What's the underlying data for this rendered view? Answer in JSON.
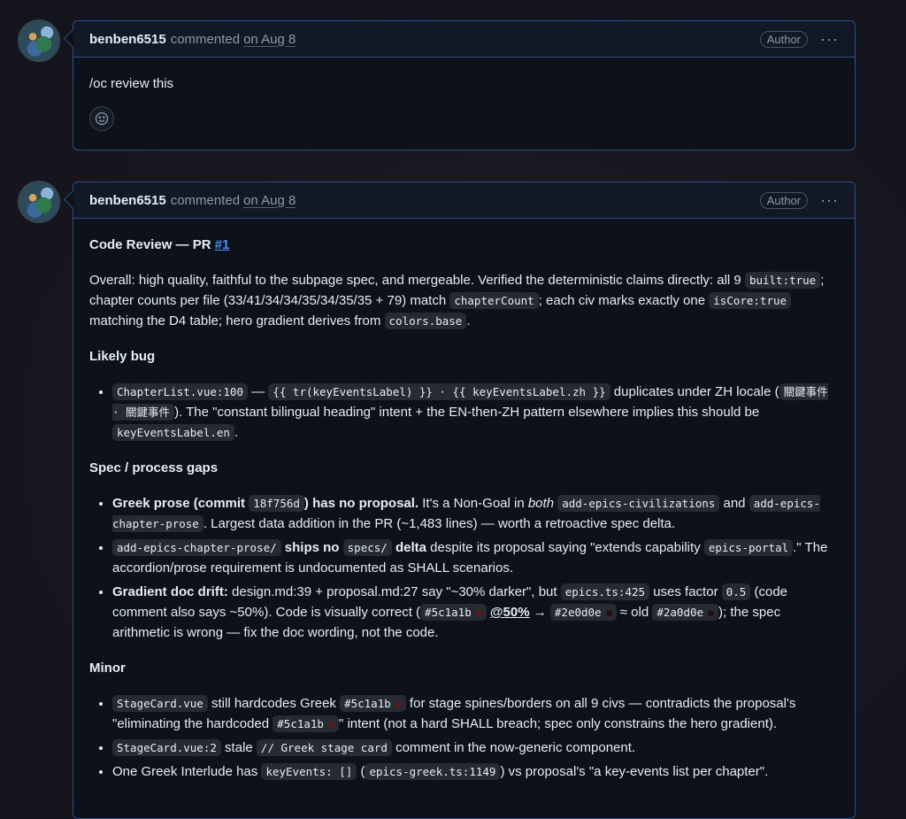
{
  "comments": [
    {
      "author": "benben6515",
      "action": "commented",
      "date": "on Aug 8",
      "badge": "Author",
      "menu": "···",
      "body": "/oc review this",
      "reaction_icon": "smiley-icon"
    },
    {
      "author": "benben6515",
      "action": "commented",
      "date": "on Aug 8",
      "badge": "Author",
      "menu": "···"
    }
  ],
  "review": {
    "title_prefix": "Code Review — PR ",
    "title_link": "#1",
    "overall": {
      "t1": "Overall: high quality, faithful to the subpage spec, and mergeable. Verified the deterministic claims directly: all 9 ",
      "c1": "built:true",
      "t2": "; chapter counts per file (33/41/34/34/35/34/35/35 + 79) match ",
      "c2": "chapterCount",
      "t3": "; each civ marks exactly one ",
      "c3": "isCore:true",
      "t4": " matching the D4 table; hero gradient derives from ",
      "c4": "colors.base",
      "t5": "."
    },
    "likely_bug": {
      "heading": "Likely bug",
      "c1": "ChapterList.vue:100",
      "t1": " — ",
      "c2": "{{ tr(keyEventsLabel) }} · {{ keyEventsLabel.zh }}",
      "t2": " duplicates under ZH locale (",
      "c3": "關鍵事件 · 關鍵事件",
      "t3": "). The \"constant bilingual heading\" intent + the EN-then-ZH pattern elsewhere implies this should be ",
      "c4": "keyEventsLabel.en",
      "t4": "."
    },
    "spec": {
      "heading": "Spec / process gaps",
      "i1": {
        "b1": "Greek prose (commit ",
        "c1": "18f756d",
        "b2": ") has no proposal.",
        "t1": " It's a Non-Goal in ",
        "em": "both",
        "t2": " ",
        "c2": "add-epics-civilizations",
        "t3": " and ",
        "c3": "add-epics-chapter-prose",
        "t4": ". Largest data addition in the PR (~1,483 lines) — worth a retroactive spec delta."
      },
      "i2": {
        "c1": "add-epics-chapter-prose/",
        "b1": " ships no ",
        "c2": "specs/",
        "b2": " delta",
        "t1": " despite its proposal saying \"extends capability ",
        "c3": "epics-portal",
        "t2": ".\" The accordion/prose requirement is undocumented as SHALL scenarios."
      },
      "i3": {
        "b1": "Gradient doc drift:",
        "t1": " design.md:39 + proposal.md:27 say \"~30% darker\", but ",
        "c1": "epics.ts:425",
        "t2": " uses factor ",
        "c2": "0.5",
        "t3": " (code comment also says ~50%). Code is visually correct (",
        "c3": "#5c1a1b",
        "mention": "@50%",
        "t4": " → ",
        "c4": "#2e0d0e",
        "t5": " ≈ old ",
        "c5": "#2a0d0e",
        "t6": "); the spec arithmetic is wrong — fix the doc wording, not the code."
      }
    },
    "minor": {
      "heading": "Minor",
      "i1": {
        "c1": "StageCard.vue",
        "t1": " still hardcodes Greek ",
        "c2": "#5c1a1b",
        "t2": " for stage spines/borders on all 9 civs — contradicts the proposal's \"eliminating the hardcoded ",
        "c3": "#5c1a1b",
        "t3": "\" intent (not a hard SHALL breach; spec only constrains the hero gradient)."
      },
      "i2": {
        "c1": "StageCard.vue:2",
        "t1": " stale ",
        "c2": "// Greek stage card",
        "t2": " comment in the now-generic component."
      },
      "i3": {
        "t1": "One Greek Interlude has ",
        "c1": "keyEvents: []",
        "t2": " (",
        "c2": "epics-greek.ts:1149",
        "t3": ") vs proposal's \"a key-events list per chapter\"."
      }
    }
  },
  "swatch_colors": {
    "c5c1a1b": "#5c1a1b",
    "c2e0d0e": "#2e0d0e",
    "c2a0d0e": "#2a0d0e"
  }
}
